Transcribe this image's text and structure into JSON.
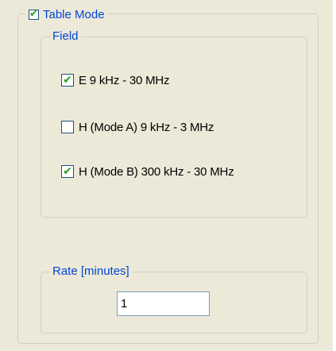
{
  "table_mode": {
    "label": "Table Mode",
    "checked": true
  },
  "field_group": {
    "label": "Field",
    "options": [
      {
        "label": "E 9 kHz - 30 MHz",
        "checked": true
      },
      {
        "label": "H (Mode A) 9 kHz - 3 MHz",
        "checked": false
      },
      {
        "label": "H (Mode B) 300 kHz - 30 MHz",
        "checked": true
      }
    ]
  },
  "rate_group": {
    "label": "Rate [minutes]",
    "value": "1"
  },
  "colors": {
    "legend_text": "#0046d5",
    "check_mark": "#21a121",
    "panel_bg": "#ece9d8"
  },
  "icons": {
    "checkbox_checked": "check-icon"
  }
}
